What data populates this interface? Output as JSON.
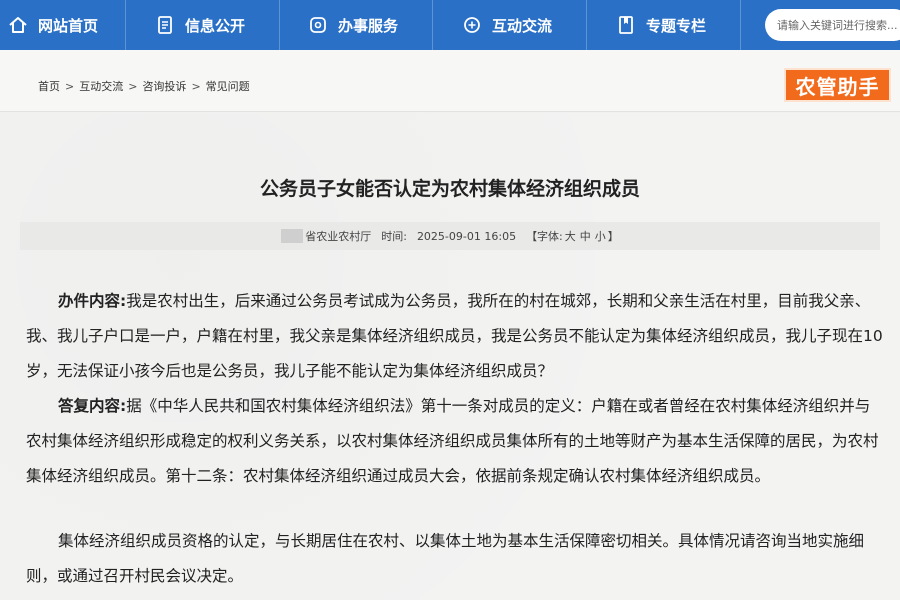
{
  "nav": {
    "items": [
      {
        "label": "网站首页",
        "icon": "home-icon"
      },
      {
        "label": "信息公开",
        "icon": "document-icon"
      },
      {
        "label": "办事服务",
        "icon": "service-icon"
      },
      {
        "label": "互动交流",
        "icon": "chat-icon"
      },
      {
        "label": "专题专栏",
        "icon": "bookmark-icon"
      }
    ],
    "search_placeholder": "请输入关键词进行搜索..."
  },
  "breadcrumb": {
    "items": [
      "首页",
      "互动交流",
      "咨询投诉",
      "常见问题"
    ],
    "separator": ">"
  },
  "badge": "农管助手",
  "article": {
    "title": "公务员子女能否认定为农村集体经济组织成员",
    "source": "省农业农村厅",
    "time_label": "时间:",
    "time": "2025-09-01 16:05",
    "font_label": "【字体:",
    "font_sizes": [
      "大",
      "中",
      "小"
    ],
    "font_close": "】",
    "q_label": "办件内容:",
    "q_text": "我是农村出生，后来通过公务员考试成为公务员，我所在的村在城郊，长期和父亲生活在村里，目前我父亲、我、我儿子户口是一户，户籍在村里，我父亲是集体经济组织成员，我是公务员不能认定为集体经济组织成员，我儿子现在10岁，无法保证小孩今后也是公务员，我儿子能不能认定为集体经济组织成员？",
    "a_label": "答复内容:",
    "a_text": "据《中华人民共和国农村集体经济组织法》第十一条对成员的定义：户籍在或者曾经在农村集体经济组织并与农村集体经济组织形成稳定的权利义务关系，以农村集体经济组织成员集体所有的土地等财产为基本生活保障的居民，为农村集体经济组织成员。第十二条：农村集体经济组织通过成员大会，依据前条规定确认农村集体经济组织成员。",
    "p3_text": "集体经济组织成员资格的认定，与长期居住在农村、以集体土地为基本生活保障密切相关。具体情况请咨询当地实施细则，或通过召开村民会议决定。"
  },
  "colors": {
    "nav_bg": "#2a70c6",
    "badge_bg": "#f26a1b",
    "text": "#222222"
  }
}
